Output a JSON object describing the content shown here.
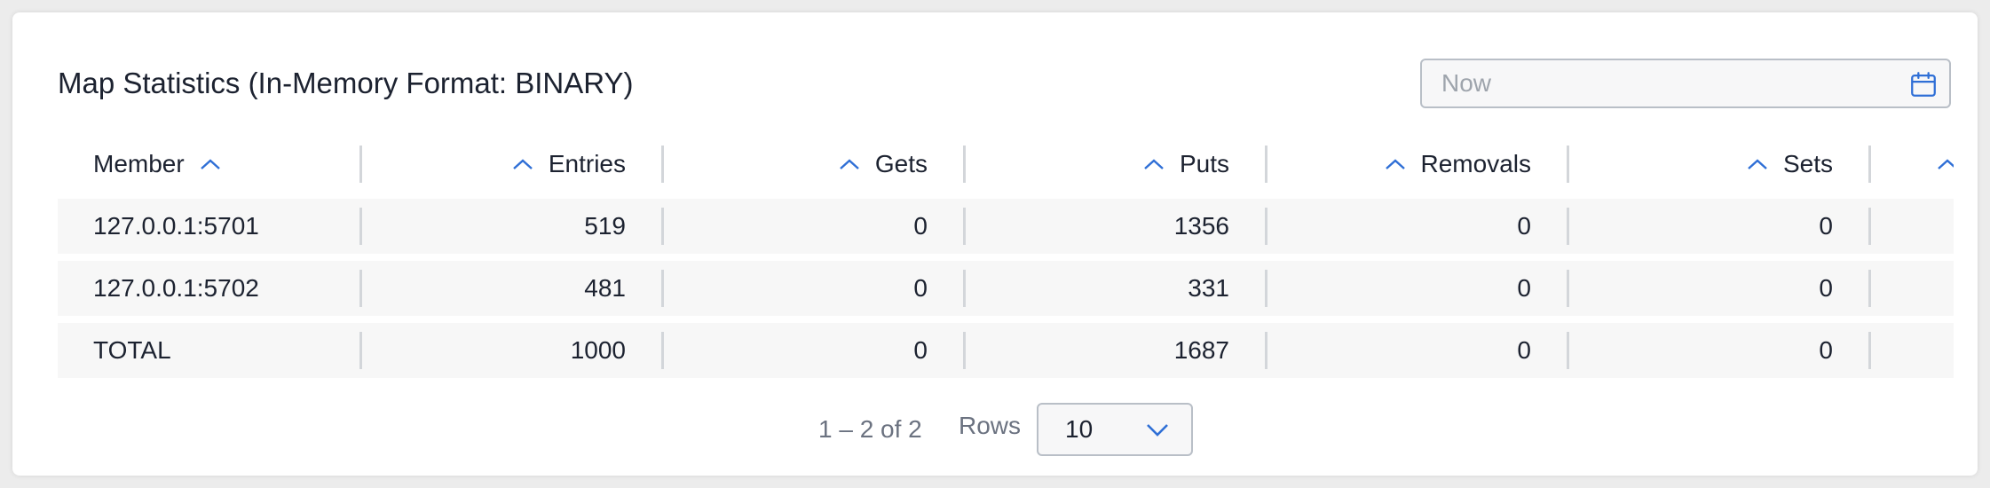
{
  "panel": {
    "title": "Map Statistics (In-Memory Format: BINARY)"
  },
  "date_picker": {
    "value": "",
    "placeholder": "Now",
    "icon": "calendar-icon"
  },
  "table": {
    "columns": [
      {
        "label": "Member",
        "sort_icon": "chevron-up-icon"
      },
      {
        "label": "Entries",
        "sort_icon": "chevron-up-icon"
      },
      {
        "label": "Gets",
        "sort_icon": "chevron-up-icon"
      },
      {
        "label": "Puts",
        "sort_icon": "chevron-up-icon"
      },
      {
        "label": "Removals",
        "sort_icon": "chevron-up-icon"
      },
      {
        "label": "Sets",
        "sort_icon": "chevron-up-icon"
      },
      {
        "label": "",
        "sort_icon": "chevron-up-icon"
      }
    ],
    "rows": [
      {
        "member": "127.0.0.1:5701",
        "entries": "519",
        "gets": "0",
        "puts": "1356",
        "removals": "0",
        "sets": "0"
      },
      {
        "member": "127.0.0.1:5702",
        "entries": "481",
        "gets": "0",
        "puts": "331",
        "removals": "0",
        "sets": "0"
      },
      {
        "member": "TOTAL",
        "entries": "1000",
        "gets": "0",
        "puts": "1687",
        "removals": "0",
        "sets": "0"
      }
    ]
  },
  "pagination": {
    "range_text": "1 – 2 of 2",
    "rows_label": "Rows",
    "rows_per_page": "10",
    "dropdown_icon": "chevron-down-icon"
  },
  "colors": {
    "accent": "#2f6fd6",
    "text": "#1c2230",
    "muted": "#6b7280",
    "row_bg": "#f7f7f7",
    "divider": "#d3d6da"
  }
}
